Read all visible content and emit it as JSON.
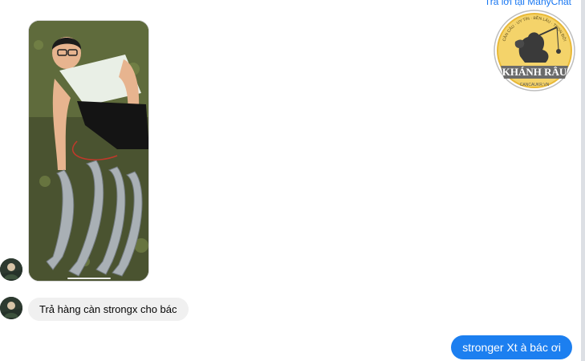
{
  "header": {
    "reply_link": "Trả lời tại ManyChat"
  },
  "logo": {
    "name": "KHÁNH RÂU",
    "arc_text": "CẦN CÂU · UY TÍN · BỀN LÂU · TRỌN ĐỜI",
    "url_text": "CANCAUKR.VN",
    "colors": {
      "ring": "#f2c94c",
      "disk": "#f4d36a",
      "banner": "#6b6b6b"
    }
  },
  "messages": [
    {
      "sender": "contact",
      "type": "image",
      "image": "photo-man-with-four-fish"
    },
    {
      "sender": "contact",
      "type": "text",
      "text": "Trả hàng càn strongx cho bác"
    },
    {
      "sender": "me",
      "type": "text",
      "text": "stronger Xt à bác ơi"
    }
  ],
  "colors": {
    "incoming_bubble": "#f0f0f0",
    "outgoing_bubble": "#1c7ff0",
    "link": "#1877f2"
  }
}
